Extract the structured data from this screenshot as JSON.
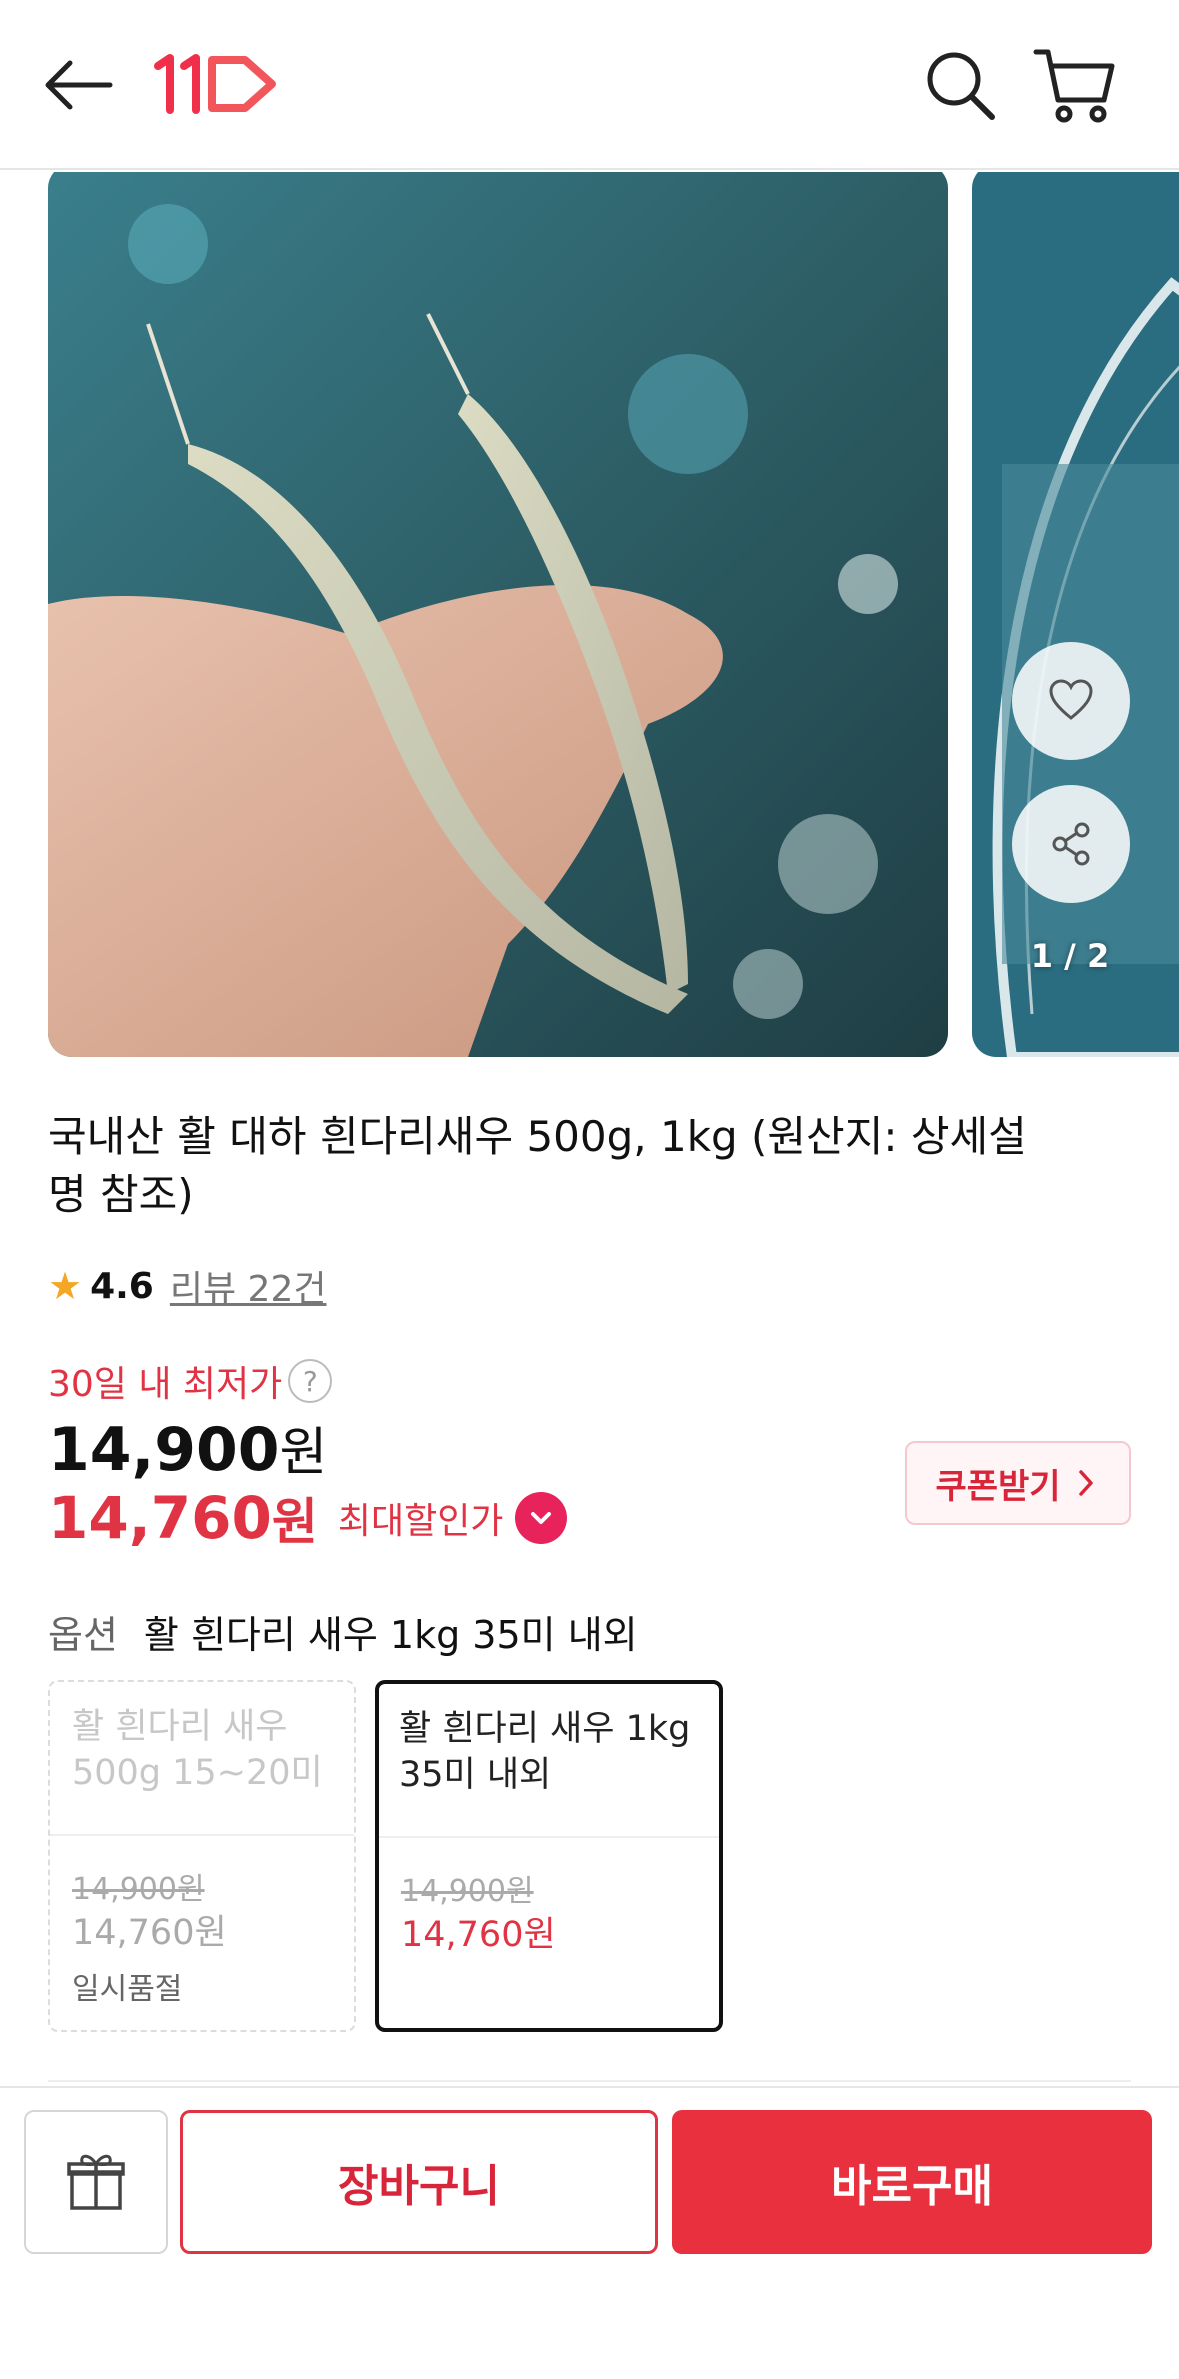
{
  "header": {
    "back_icon": "arrow-left-icon",
    "logo_text": "11",
    "search_icon": "search-icon",
    "cart_icon": "cart-icon"
  },
  "gallery": {
    "page_indicator": "1 / 2",
    "fav_icon": "heart-icon",
    "share_icon": "share-icon"
  },
  "product": {
    "title": "국내산 활 대하 흰다리새우 500g, 1kg (원산지: 상세설명 참조)",
    "rating": "4.6",
    "review_link": "리뷰 22건"
  },
  "price": {
    "lowest_label": "30일 내 최저가",
    "help_glyph": "?",
    "original_value": "14,900",
    "original_unit": "원",
    "sale_value": "14,760",
    "sale_unit": "원",
    "max_discount_label": "최대할인가",
    "coupon_label": "쿠폰받기"
  },
  "options": {
    "label": "옵션",
    "selected": "활 흰다리 새우 1kg 35미 내외",
    "cards": [
      {
        "name": "활 흰다리 새우 500g 15~20미",
        "old_price": "14,900원",
        "new_price": "14,760원",
        "status": "일시품절"
      },
      {
        "name": "활 흰다리 새우 1kg  35미 내외",
        "old_price": "14,900원",
        "new_price": "14,760원",
        "status": ""
      }
    ]
  },
  "bottom": {
    "gift_icon": "gift-icon",
    "cart_label": "장바구니",
    "buy_label": "바로구매"
  },
  "colors": {
    "accent": "#e8303f",
    "sale_text": "#e03444",
    "star": "#f5a623"
  }
}
